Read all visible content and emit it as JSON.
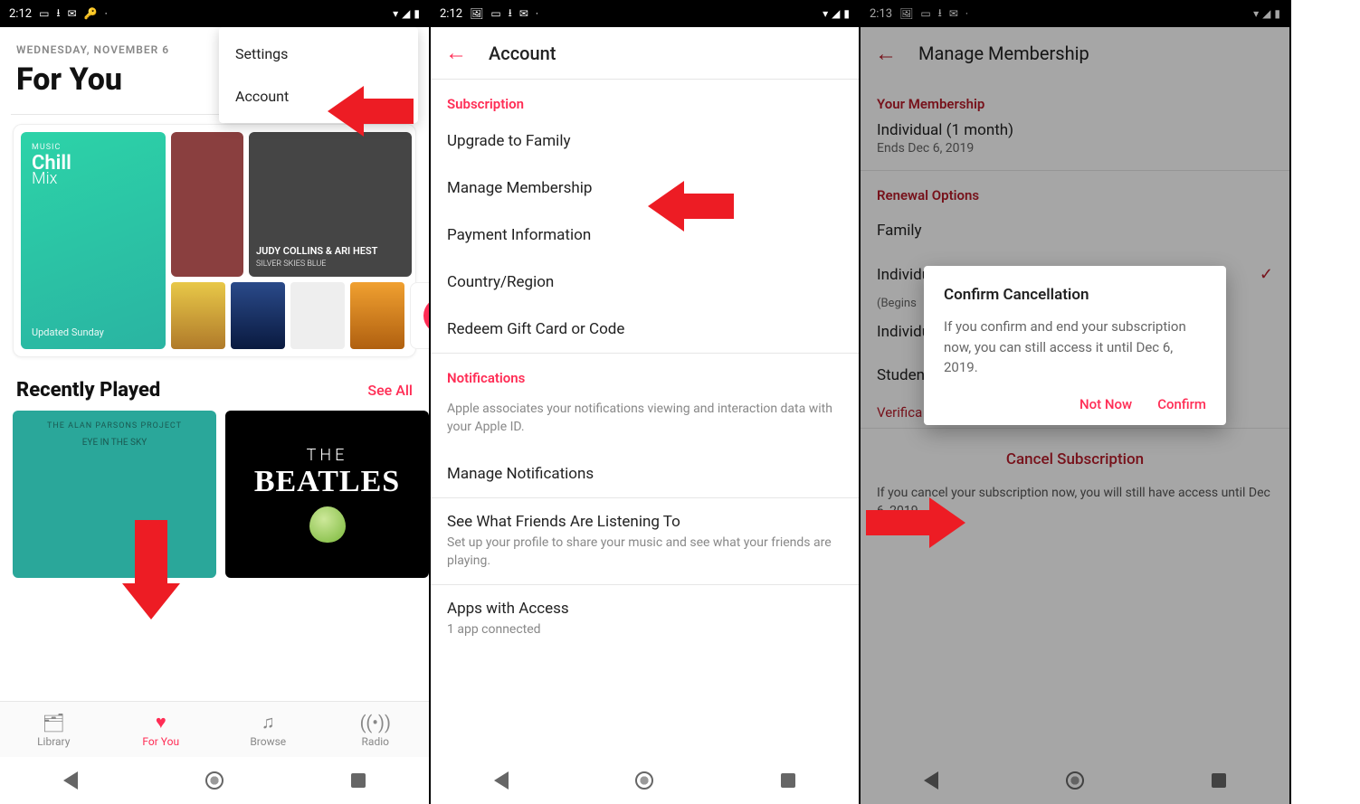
{
  "panel1": {
    "status_time": "2:12",
    "date_upper": "WEDNESDAY, NOVEMBER 6",
    "title": "For You",
    "dropdown": {
      "settings": "Settings",
      "account": "Account"
    },
    "chill": {
      "am": "MUSIC",
      "line1": "Chill",
      "line2": "Mix",
      "updated": "Updated Sunday"
    },
    "judy": "JUDY COLLINS & ARI HEST",
    "judy_sub": "SILVER SKIES BLUE",
    "recently_played": "Recently Played",
    "see_all": "See All",
    "rp1_top": "THE ALAN PARSONS PROJECT",
    "rp1_sub": "EYE IN THE SKY",
    "rp2_top": "THE",
    "rp2_main": "BEATLES",
    "tabs": {
      "library": "Library",
      "foryou": "For You",
      "browse": "Browse",
      "radio": "Radio"
    }
  },
  "panel2": {
    "status_time": "2:12",
    "title": "Account",
    "subscription_label": "Subscription",
    "items": {
      "upgrade": "Upgrade to Family",
      "manage": "Manage Membership",
      "payment": "Payment Information",
      "country": "Country/Region",
      "redeem": "Redeem Gift Card or Code"
    },
    "notifications_label": "Notifications",
    "notifications_desc": "Apple associates your notifications viewing and interaction data with your Apple ID.",
    "manage_notifications": "Manage Notifications",
    "friends_title": "See What Friends Are Listening To",
    "friends_desc": "Set up your profile to share your music and see what your friends are playing.",
    "apps_title": "Apps with Access",
    "apps_desc": "1 app connected"
  },
  "panel3": {
    "status_time": "2:13",
    "title": "Manage Membership",
    "your_membership_label": "Your Membership",
    "plan": "Individual (1 month)",
    "ends": "Ends Dec 6, 2019",
    "renewal_label": "Renewal Options",
    "opt_family": "Family",
    "opt_individual": "Individual",
    "opt_individual_sub": "(Begins",
    "opt_individual2": "Individual",
    "opt_student": "Student",
    "verification": "Verifica",
    "cancel": "Cancel Subscription",
    "cancel_note": "If you cancel your subscription now, you will still have access until Dec 6, 2019.",
    "dialog": {
      "title": "Confirm Cancellation",
      "body": "If you confirm and end your subscription now, you can still access it until Dec 6, 2019.",
      "not_now": "Not Now",
      "confirm": "Confirm"
    }
  }
}
